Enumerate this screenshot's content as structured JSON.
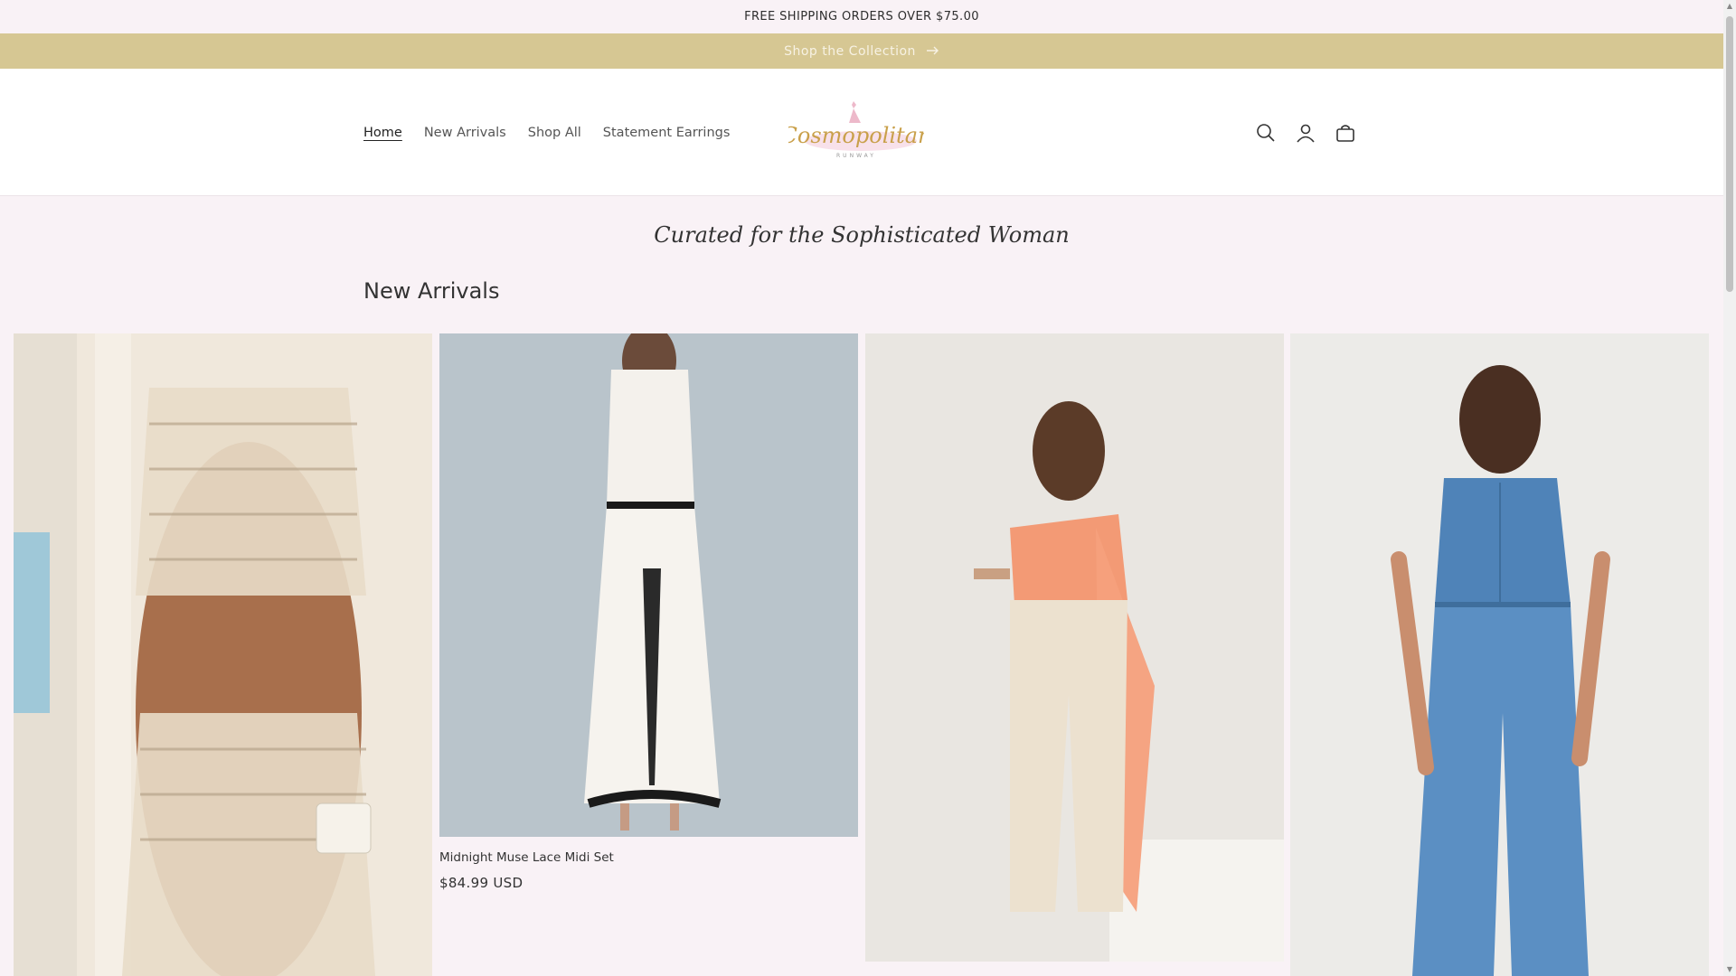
{
  "announcement": {
    "text": "FREE SHIPPING ORDERS OVER $75.00"
  },
  "collection_bar": {
    "label": "Shop the Collection"
  },
  "nav": {
    "items": [
      {
        "label": "Home",
        "active": true
      },
      {
        "label": "New Arrivals",
        "active": false
      },
      {
        "label": "Shop All",
        "active": false
      },
      {
        "label": "Statement Earrings",
        "active": false
      }
    ]
  },
  "logo": {
    "text": "Cosmopolitan",
    "subtext": "RUNWAY"
  },
  "header_icons": [
    "search-icon",
    "account-icon",
    "cart-icon"
  ],
  "tagline": "Curated for the Sophisticated Woman",
  "section": {
    "title": "New Arrivals"
  },
  "products": [
    {
      "name": "",
      "price": ""
    },
    {
      "name": "Midnight Muse Lace Midi Set",
      "price": "$84.99 USD"
    },
    {
      "name": "",
      "price": ""
    },
    {
      "name": "",
      "price": ""
    }
  ],
  "colors": {
    "page_bg": "#f9f2f6",
    "collection_bar_bg": "#d6c793",
    "header_bg": "#ffffff",
    "logo_gold": "#c9a04a",
    "logo_pink": "#e6a9c0"
  }
}
